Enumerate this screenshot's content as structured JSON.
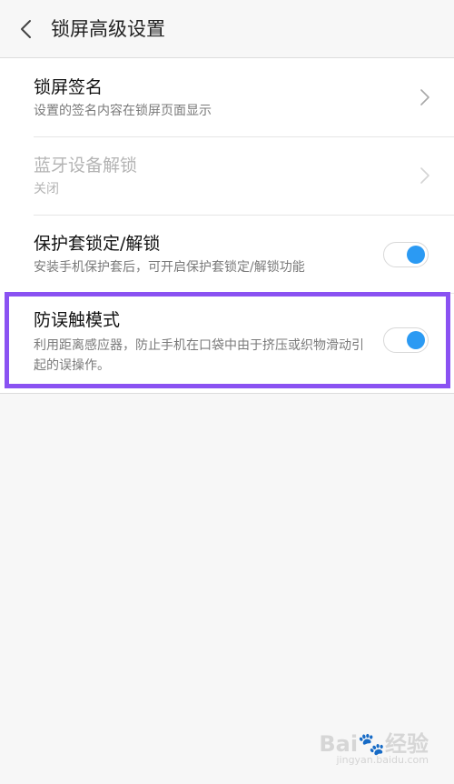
{
  "header": {
    "title": "锁屏高级设置"
  },
  "items": [
    {
      "title": "锁屏签名",
      "subtitle": "设置的签名内容在锁屏页面显示",
      "control": "chevron",
      "enabled": true
    },
    {
      "title": "蓝牙设备解锁",
      "subtitle": "关闭",
      "control": "chevron",
      "enabled": false
    },
    {
      "title": "保护套锁定/解锁",
      "subtitle": "安装手机保护套后，可开启保护套锁定/解锁功能",
      "control": "toggle",
      "on": true
    },
    {
      "title": "防误触模式",
      "subtitle": "利用距离感应器，防止手机在口袋中由于挤压或织物滑动引起的误操作。",
      "control": "toggle",
      "on": true
    }
  ],
  "watermark": {
    "brand": "Bai🐾经验",
    "url": "jingyan.baidu.com"
  },
  "colors": {
    "toggle_on": "#2b9af3",
    "highlight": "#8a52f2"
  }
}
